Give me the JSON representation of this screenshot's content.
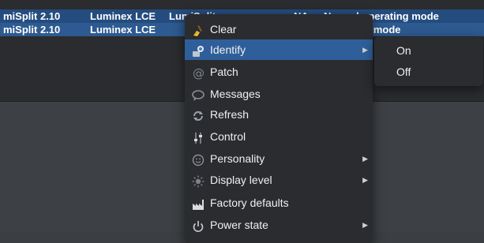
{
  "table": {
    "rows": [
      {
        "model": "miSplit 2.10",
        "manufacturer": "Luminex LCE",
        "name": "LumiSplit",
        "address": "NA",
        "status": "Normal operating mode"
      },
      {
        "model": "miSplit 2.10",
        "manufacturer": "Luminex LCE",
        "name": "",
        "address": "",
        "status": "operating mode"
      }
    ]
  },
  "context_menu": {
    "items": [
      {
        "label": "Clear",
        "icon": "broom-icon"
      },
      {
        "label": "Identify",
        "icon": "identify-icon",
        "has_submenu": true,
        "active": true
      },
      {
        "label": "Patch",
        "icon": "at-icon"
      },
      {
        "label": "Messages",
        "icon": "speech-bubble-icon"
      },
      {
        "label": "Refresh",
        "icon": "refresh-icon"
      },
      {
        "label": "Control",
        "icon": "control-icon"
      },
      {
        "label": "Personality",
        "icon": "smiley-icon",
        "has_submenu": true
      },
      {
        "label": "Display level",
        "icon": "brightness-icon",
        "has_submenu": true
      },
      {
        "label": "Factory defaults",
        "icon": "factory-icon"
      },
      {
        "label": "Power state",
        "icon": "power-icon",
        "has_submenu": true
      }
    ]
  },
  "submenu": {
    "items": [
      {
        "label": "On"
      },
      {
        "label": "Off"
      }
    ]
  },
  "colors": {
    "selection_row": "#244c7e",
    "menu_bg": "#2b2c2f",
    "menu_highlight": "#2f5f9a"
  }
}
